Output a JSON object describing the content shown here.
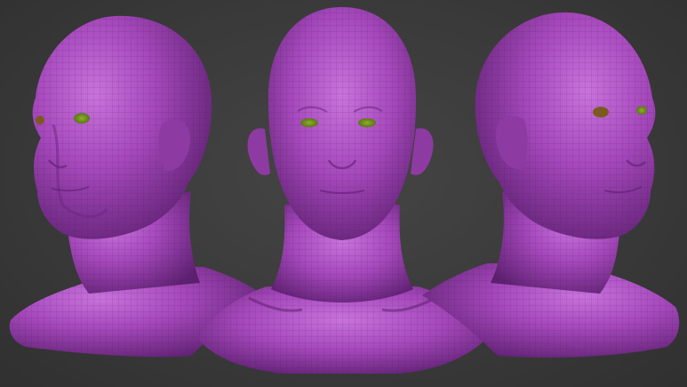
{
  "scene": {
    "background_color": "#3a3a3a",
    "mesh_color": "#9a3fb0",
    "mesh_highlight": "#c46ad6",
    "mesh_shadow": "#5a1f6e",
    "wire_color": "#4d1b5e",
    "eye_color": "#6f8a1e",
    "views": [
      {
        "name": "three-quarter-left"
      },
      {
        "name": "front"
      },
      {
        "name": "three-quarter-right"
      }
    ]
  }
}
